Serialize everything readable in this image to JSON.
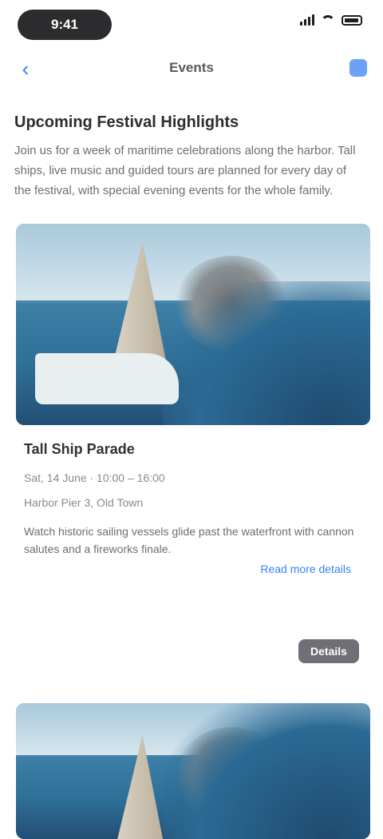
{
  "status_bar": {
    "time": "9:41"
  },
  "nav": {
    "back_icon": "chevron-left-icon",
    "title": "Events",
    "action_icon": "share-icon"
  },
  "content": {
    "heading": "Upcoming Festival Highlights",
    "intro": "Join us for a week of maritime celebrations along the harbor. Tall ships, live music and guided tours are planned for every day of the festival, with special evening events for the whole family.",
    "card": {
      "title": "Tall Ship Parade",
      "date": "Sat, 14 June · 10:00 – 16:00",
      "place": "Harbor Pier 3, Old Town",
      "description": "Watch historic sailing vessels glide past the waterfront with cannon salutes and a fireworks finale.",
      "read_more": "Read more details"
    },
    "secondary_button": "Details"
  },
  "colors": {
    "accent": "#3b82f6",
    "button_grey": "#6f6f75"
  }
}
